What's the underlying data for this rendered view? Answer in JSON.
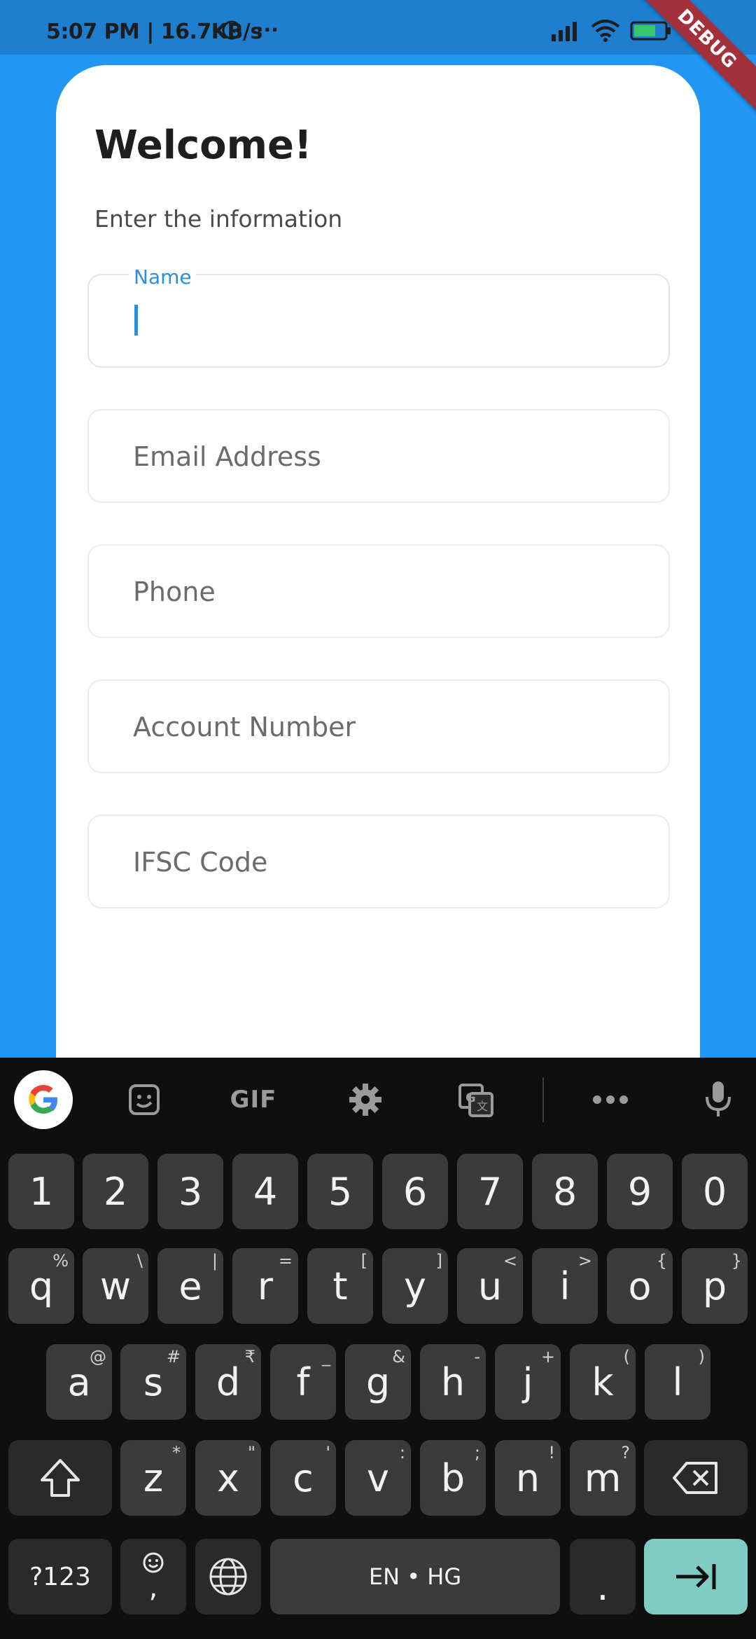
{
  "status": {
    "time_speed": "5:07 PM | 16.7KB/s",
    "battery": "65",
    "debug_label": "DEBUG"
  },
  "form": {
    "title": "Welcome!",
    "subtitle": "Enter the information",
    "fields": [
      {
        "label": "Name",
        "value": ""
      },
      {
        "placeholder": "Email Address"
      },
      {
        "placeholder": "Phone"
      },
      {
        "placeholder": "Account Number"
      },
      {
        "placeholder": "IFSC Code"
      }
    ]
  },
  "keyboard": {
    "toolbar": {
      "gif": "GIF"
    },
    "number_row": [
      "1",
      "2",
      "3",
      "4",
      "5",
      "6",
      "7",
      "8",
      "9",
      "0"
    ],
    "row1": [
      {
        "k": "q",
        "a": "%"
      },
      {
        "k": "w",
        "a": "\\"
      },
      {
        "k": "e",
        "a": "|"
      },
      {
        "k": "r",
        "a": "="
      },
      {
        "k": "t",
        "a": "["
      },
      {
        "k": "y",
        "a": "]"
      },
      {
        "k": "u",
        "a": "<"
      },
      {
        "k": "i",
        "a": ">"
      },
      {
        "k": "o",
        "a": "{"
      },
      {
        "k": "p",
        "a": "}"
      }
    ],
    "row2": [
      {
        "k": "a",
        "a": "@"
      },
      {
        "k": "s",
        "a": "#"
      },
      {
        "k": "d",
        "a": "₹"
      },
      {
        "k": "f",
        "a": "_"
      },
      {
        "k": "g",
        "a": "&"
      },
      {
        "k": "h",
        "a": "-"
      },
      {
        "k": "j",
        "a": "+"
      },
      {
        "k": "k",
        "a": "("
      },
      {
        "k": "l",
        "a": ")"
      }
    ],
    "row3": [
      {
        "k": "z",
        "a": "*"
      },
      {
        "k": "x",
        "a": "\""
      },
      {
        "k": "c",
        "a": "'"
      },
      {
        "k": "v",
        "a": ":"
      },
      {
        "k": "b",
        "a": ";"
      },
      {
        "k": "n",
        "a": "!"
      },
      {
        "k": "m",
        "a": "?"
      }
    ],
    "symbols_label": "?123",
    "comma_label": ",",
    "space_label": "EN • HG",
    "period_label": "."
  },
  "colors": {
    "background": "#2196f3",
    "accent": "#2a8fe0",
    "enter_key": "#80cbc4",
    "debug_ribbon": "#a3303b"
  }
}
